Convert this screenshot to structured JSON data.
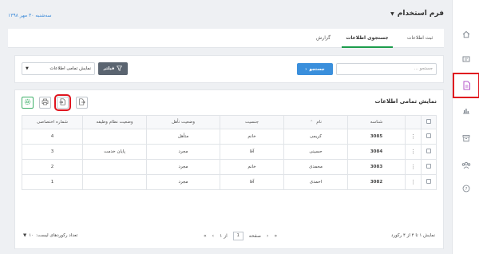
{
  "header": {
    "title": "فرم استخدام",
    "date": "سه‌شنبه ۳۰ مهر ۱۳۹۸"
  },
  "tabs": [
    {
      "label": "ثبت اطلاعات"
    },
    {
      "label": "جستجوی اطلاعات"
    },
    {
      "label": "گزارش"
    }
  ],
  "search": {
    "placeholder": "جستجو ...",
    "button_label": "جستجو",
    "filter_label": "فیلتر",
    "view_select_value": "نمایش تمامی اطلاعات"
  },
  "table": {
    "title": "نمایش تمامی اطلاعات",
    "columns": [
      "شناسه",
      "نام",
      "جنسیت",
      "وضعیت تأهل",
      "وضعیت نظام وظیفه",
      "شماره اختصاصی"
    ],
    "rows": [
      {
        "id": "3085",
        "name": "کریمی",
        "gender": "خانم",
        "marital": "متأهل",
        "military": "",
        "number": "4"
      },
      {
        "id": "3084",
        "name": "حسینی",
        "gender": "آقا",
        "marital": "مجرد",
        "military": "پایان خدمت",
        "number": "3"
      },
      {
        "id": "3083",
        "name": "محمدی",
        "gender": "خانم",
        "marital": "مجرد",
        "military": "",
        "number": "2"
      },
      {
        "id": "3082",
        "name": "احمدی",
        "gender": "آقا",
        "marital": "مجرد",
        "military": "",
        "number": "1"
      }
    ]
  },
  "footer": {
    "summary": "نمایش ۱ تا ۴ از ۴ رکورد",
    "page_label": "صفحه",
    "page_value": "1",
    "of_label": "از ۱",
    "page_size_label": "تعداد رکوردهای لیست:",
    "page_size_value": "۱۰"
  },
  "colors": {
    "accent_blue": "#3a8fdc",
    "active_tab_green": "#1c9c4c",
    "highlight_red": "#e0151f"
  }
}
